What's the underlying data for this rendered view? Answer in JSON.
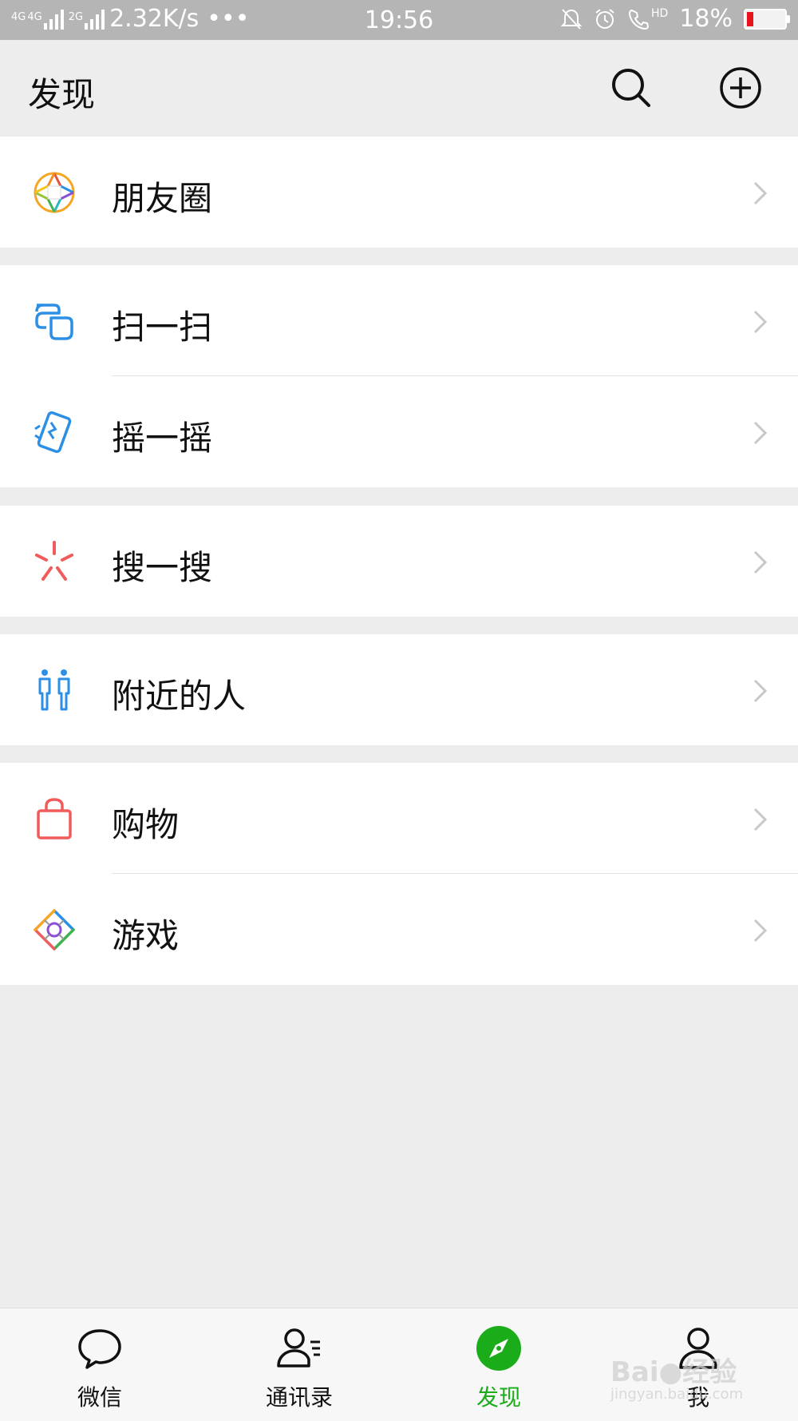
{
  "status_bar": {
    "network_1": "4G",
    "network_2": "4G",
    "network_3": "2G",
    "speed": "2.32K/s",
    "more": "•••",
    "time": "19:56",
    "battery_percent": "18%",
    "hd_label": "HD",
    "battery_level": 0.18,
    "battery_color": "#e8141b"
  },
  "header": {
    "title": "发现",
    "search_icon": "search-icon",
    "add_icon": "plus-circle-icon"
  },
  "menu": {
    "moments": {
      "label": "朋友圈",
      "icon": "moments-aperture-icon"
    },
    "scan": {
      "label": "扫一扫",
      "icon": "scan-icon"
    },
    "shake": {
      "label": "摇一摇",
      "icon": "shake-icon"
    },
    "search": {
      "label": "搜一搜",
      "icon": "search-sparkle-icon"
    },
    "nearby": {
      "label": "附近的人",
      "icon": "people-nearby-icon"
    },
    "shopping": {
      "label": "购物",
      "icon": "shopping-bag-icon"
    },
    "games": {
      "label": "游戏",
      "icon": "games-diamond-icon"
    }
  },
  "tabbar": {
    "tabs": [
      {
        "label": "微信",
        "icon": "chat-bubble-icon"
      },
      {
        "label": "通讯录",
        "icon": "contacts-icon"
      },
      {
        "label": "发现",
        "icon": "compass-icon"
      },
      {
        "label": "我",
        "icon": "me-person-icon"
      }
    ],
    "active_index": 2,
    "active_color": "#1aad19"
  },
  "watermark": {
    "brand": "Bai●经验",
    "url": "jingyan.baidu.com"
  },
  "colors": {
    "background": "#ededed",
    "accent_green": "#1aad19",
    "icon_blue": "#2b8fe6",
    "icon_red": "#f25b5b"
  }
}
